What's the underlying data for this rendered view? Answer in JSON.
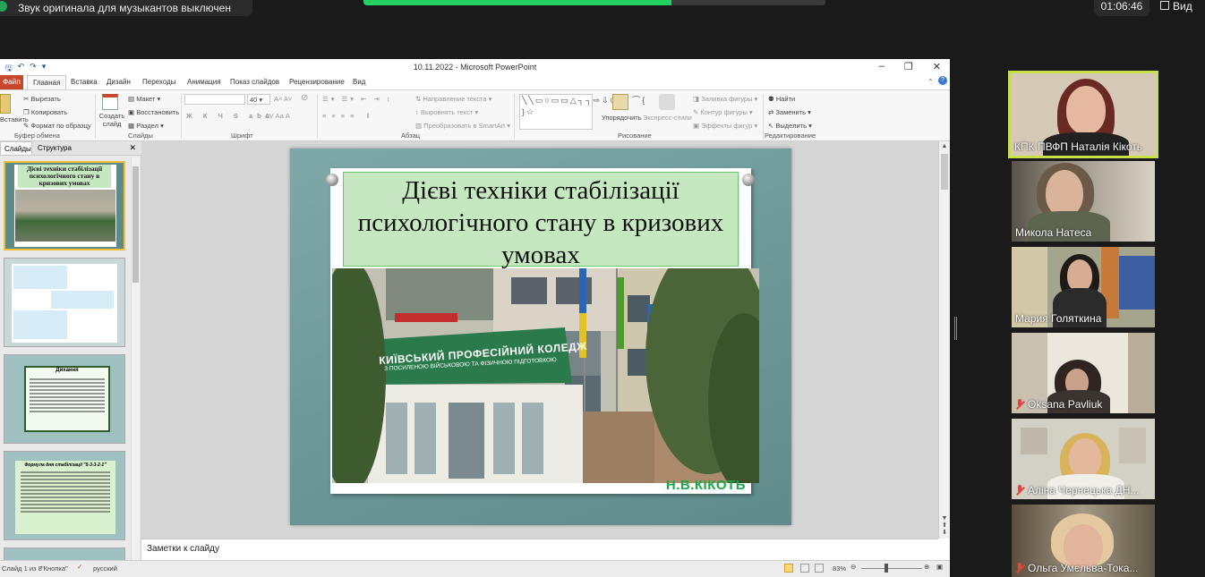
{
  "zoom": {
    "audio_notice": "Звук оригинала для музыкантов выключен",
    "timer": "01:06:46",
    "view_label": "Вид",
    "colors": {
      "share_bar": "#23d160",
      "background": "#1a1a1a"
    }
  },
  "ppt": {
    "window_title": "10.11.2022 - Microsoft PowerPoint",
    "tabs": [
      "Файл",
      "Главная",
      "Вставка",
      "Дизайн",
      "Переходы",
      "Анимация",
      "Показ слайдов",
      "Рецензирование",
      "Вид"
    ],
    "ribbon": {
      "clipboard": {
        "cut": "Вырезать",
        "copy": "Копировать",
        "format_painter": "Формат по образцу",
        "paste": "Вставить",
        "label": "Буфер обмена"
      },
      "slides": {
        "new_slide": "Создать слайд",
        "layout": "Макет",
        "reset": "Восстановить",
        "section": "Раздел",
        "label": "Слайды"
      },
      "font": {
        "size": "40",
        "label": "Шрифт"
      },
      "paragraph": {
        "text_direction": "Направление текста",
        "align_text": "Выровнять текст",
        "smartart": "Преобразовать в SmartArt",
        "label": "Абзац"
      },
      "drawing": {
        "arrange": "Упорядочить",
        "quick_styles": "Экспресс-стили",
        "shape_fill": "Заливка фигуры",
        "shape_outline": "Контур фигуры",
        "shape_effects": "Эффекты фигур",
        "label": "Рисование"
      },
      "editing": {
        "find": "Найти",
        "replace": "Заменить",
        "select": "Выделить",
        "label": "Редактирование"
      }
    },
    "panel": {
      "tab_slides": "Слайды",
      "tab_outline": "Структура",
      "thumb1_title": "Дієві техніки стабілізації психологічного стану в кризових умовах",
      "thumb3_title": "Дихання",
      "thumb4_title": "Формула дня стабілізації \"5-3-3-2-1\""
    },
    "slide": {
      "title": "Дієві техніки стабілізації психологічного стану в кризових умовах",
      "sign_line1": "КИЇВСЬКИЙ ПРОФЕСІЙНИЙ КОЛЕДЖ",
      "sign_line2": "З ПОСИЛЕНОЮ ВІЙСЬКОВОЮ ТА ФІЗИЧНОЮ ПІДГОТОВКОЮ",
      "caption": "Н.В.КІКОТЬ"
    },
    "notes_placeholder": "Заметки к слайду",
    "status": {
      "slide_counter": "Слайд 1 из 8",
      "theme": "\"Кнопка\"",
      "language": "русский",
      "zoom": "83%"
    }
  },
  "participants": [
    {
      "name": "КПК ПВФП Наталія Кікоть",
      "muted": false,
      "active": true
    },
    {
      "name": "Микола Натеса",
      "muted": false,
      "active": false
    },
    {
      "name": "Мария Голяткина",
      "muted": false,
      "active": false
    },
    {
      "name": "Oksana Pavliuk",
      "muted": true,
      "active": false
    },
    {
      "name": "Аліна Чернецька ДН...",
      "muted": true,
      "active": false
    },
    {
      "name": "Ольга Умєльва-Тока...",
      "muted": true,
      "active": false
    }
  ]
}
